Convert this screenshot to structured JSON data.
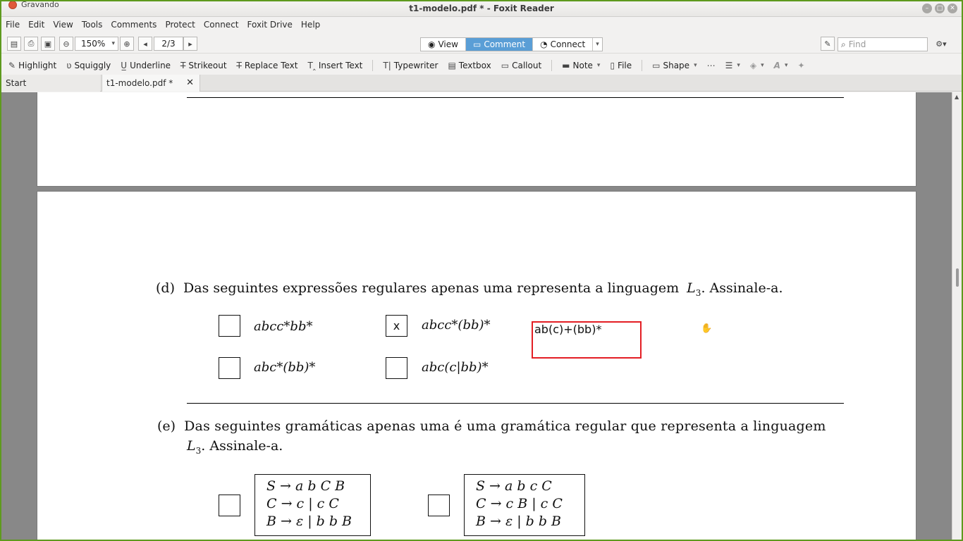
{
  "window": {
    "title": "t1-modelo.pdf * - Foxit Reader",
    "recording_label": "Gravando"
  },
  "menu": [
    "File",
    "Edit",
    "View",
    "Tools",
    "Comments",
    "Protect",
    "Connect",
    "Foxit Drive",
    "Help"
  ],
  "toolbar": {
    "zoom": "150%",
    "page": "2/3",
    "modes": [
      "View",
      "Comment",
      "Connect"
    ],
    "find_placeholder": "Find"
  },
  "comment_tools": [
    "Highlight",
    "Squiggly",
    "Underline",
    "Strikeout",
    "Replace Text",
    "Insert Text",
    "Typewriter",
    "Textbox",
    "Callout",
    "Note",
    "File",
    "Shape"
  ],
  "tabs": {
    "start": "Start",
    "doc": "t1-modelo.pdf *"
  },
  "question_d": {
    "label": "(d)",
    "text": "Das seguintes expressões regulares apenas uma representa a linguagem",
    "lang": "L",
    "lang_sub": "3",
    "suffix": ". Assinale-a.",
    "options": [
      "abcc*bb*",
      "abcc*(bb)*",
      "abc*(bb)*",
      "abc(c|bb)*"
    ],
    "checked_mark": "x",
    "annotation": "ab(c)+(bb)*"
  },
  "question_e": {
    "label": "(e)",
    "line1": "Das seguintes gramáticas apenas uma é uma gramática regular que representa a linguagem",
    "lang": "L",
    "lang_sub": "3",
    "suffix": ". Assinale-a.",
    "grammar1": [
      "S → a b C B",
      "C → c  |  c C",
      "B → ε  |  b b B"
    ],
    "grammar2": [
      "S → a b c C",
      "C → c B  |  c C",
      "B → ε  |  b b B"
    ]
  },
  "colors": {
    "accent": "#5a9ed6",
    "annotation_border": "#e31e24",
    "desktop": "#5e9a1e"
  }
}
